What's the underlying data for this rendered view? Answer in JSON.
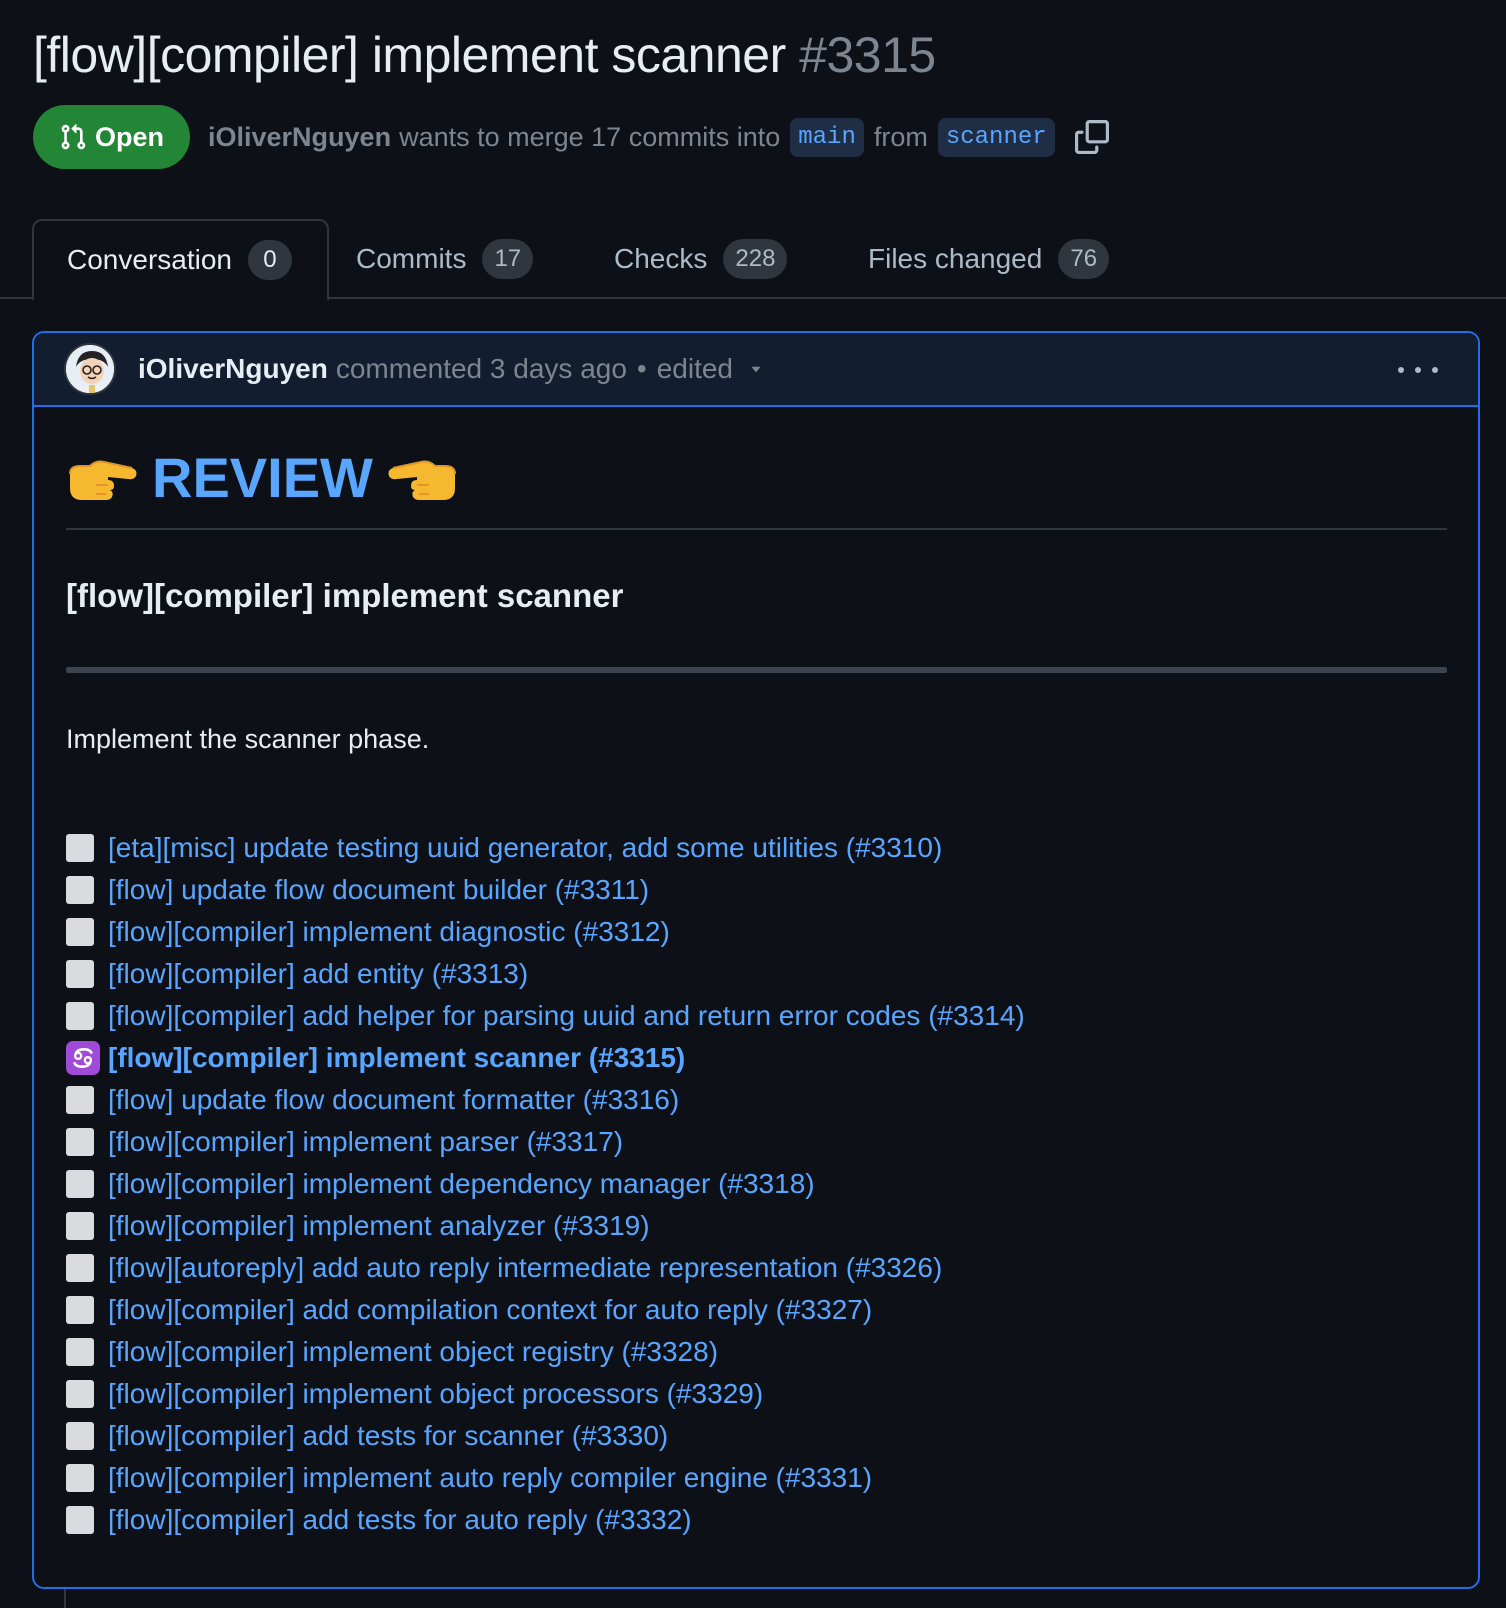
{
  "pr": {
    "title": "[flow][compiler] implement scanner",
    "number": "#3315",
    "state": "Open",
    "author": "iOliverNguyen",
    "merge_text": "wants to merge 17 commits into",
    "base_branch": "main",
    "from_text": "from",
    "head_branch": "scanner"
  },
  "tabs": [
    {
      "label": "Conversation",
      "count": "0",
      "selected": true
    },
    {
      "label": "Commits",
      "count": "17"
    },
    {
      "label": "Checks",
      "count": "228"
    },
    {
      "label": "Files changed",
      "count": "76"
    }
  ],
  "comment": {
    "author": "iOliverNguyen",
    "action": "commented 3 days ago",
    "edited": "edited",
    "review_heading": "REVIEW",
    "sub_heading": "[flow][compiler] implement scanner",
    "description": "Implement the scanner phase.",
    "stack": [
      "[eta][misc] update testing uuid generator, add some utilities (#3310)",
      "[flow] update flow document builder (#3311)",
      "[flow][compiler] implement diagnostic (#3312)",
      "[flow][compiler] add entity (#3313)",
      "[flow][compiler] add helper for parsing uuid and return error codes (#3314)",
      "[flow][compiler] implement scanner (#3315)",
      "[flow] update flow document formatter (#3316)",
      "[flow][compiler] implement parser (#3317)",
      "[flow][compiler] implement dependency manager (#3318)",
      "[flow][compiler] implement analyzer (#3319)",
      "[flow][autoreply] add auto reply intermediate representation (#3326)",
      "[flow][compiler] add compilation context for auto reply (#3327)",
      "[flow][compiler] implement object registry (#3328)",
      "[flow][compiler] implement object processors (#3329)",
      "[flow][compiler] add tests for scanner (#3330)",
      "[flow][compiler] implement auto reply compiler engine (#3331)",
      "[flow][compiler] add tests for auto reply (#3332)"
    ],
    "current_index": 5
  },
  "icons": {
    "state": "git-pull-request-icon",
    "copy": "copy-icon",
    "pending": "white-square-icon",
    "current": "cancer-zodiac-icon",
    "hands": "pointing-hand-icon"
  },
  "colors": {
    "accent": "#58a6ff",
    "open_green": "#238636",
    "current_marker": "#a04ad8"
  }
}
